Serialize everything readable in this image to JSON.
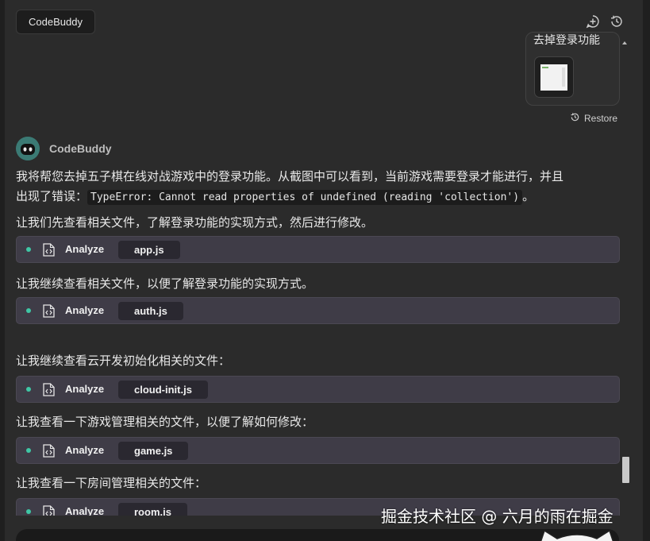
{
  "header": {
    "tab_title": "CodeBuddy",
    "icons": [
      "add-chat-icon",
      "history-icon"
    ]
  },
  "user_message": {
    "text": "去掉登录功能",
    "restore_label": "Restore"
  },
  "bot": {
    "name": "CodeBuddy",
    "intro_line1": "我将帮您去掉五子棋在线对战游戏中的登录功能。从截图中可以看到，当前游戏需要登录才能进行，并且",
    "intro_line2_prefix": "出现了错误：",
    "intro_code": "TypeError: Cannot read properties of undefined (reading 'collection')",
    "intro_line2_suffix": "。",
    "messages": [
      {
        "text": "让我们先查看相关文件，了解登录功能的实现方式，然后进行修改。",
        "action": "Analyze",
        "file": "app.js"
      },
      {
        "text": "让我继续查看相关文件，以便了解登录功能的实现方式。",
        "action": "Analyze",
        "file": "auth.js"
      },
      {
        "text": "让我继续查看云开发初始化相关的文件：",
        "action": "Analyze",
        "file": "cloud-init.js"
      },
      {
        "text": "让我查看一下游戏管理相关的文件，以便了解如何修改：",
        "action": "Analyze",
        "file": "game.js"
      },
      {
        "text": "让我查看一下房间管理相关的文件：",
        "action": "Analyze",
        "file": "room.js"
      }
    ]
  },
  "watermark": "掘金技术社区 @ 六月的雨在掘金",
  "colors": {
    "panel_bg": "#2b2b2b",
    "tool_row_bg": "#3f3c47",
    "status_dot": "#3fc7a5"
  }
}
